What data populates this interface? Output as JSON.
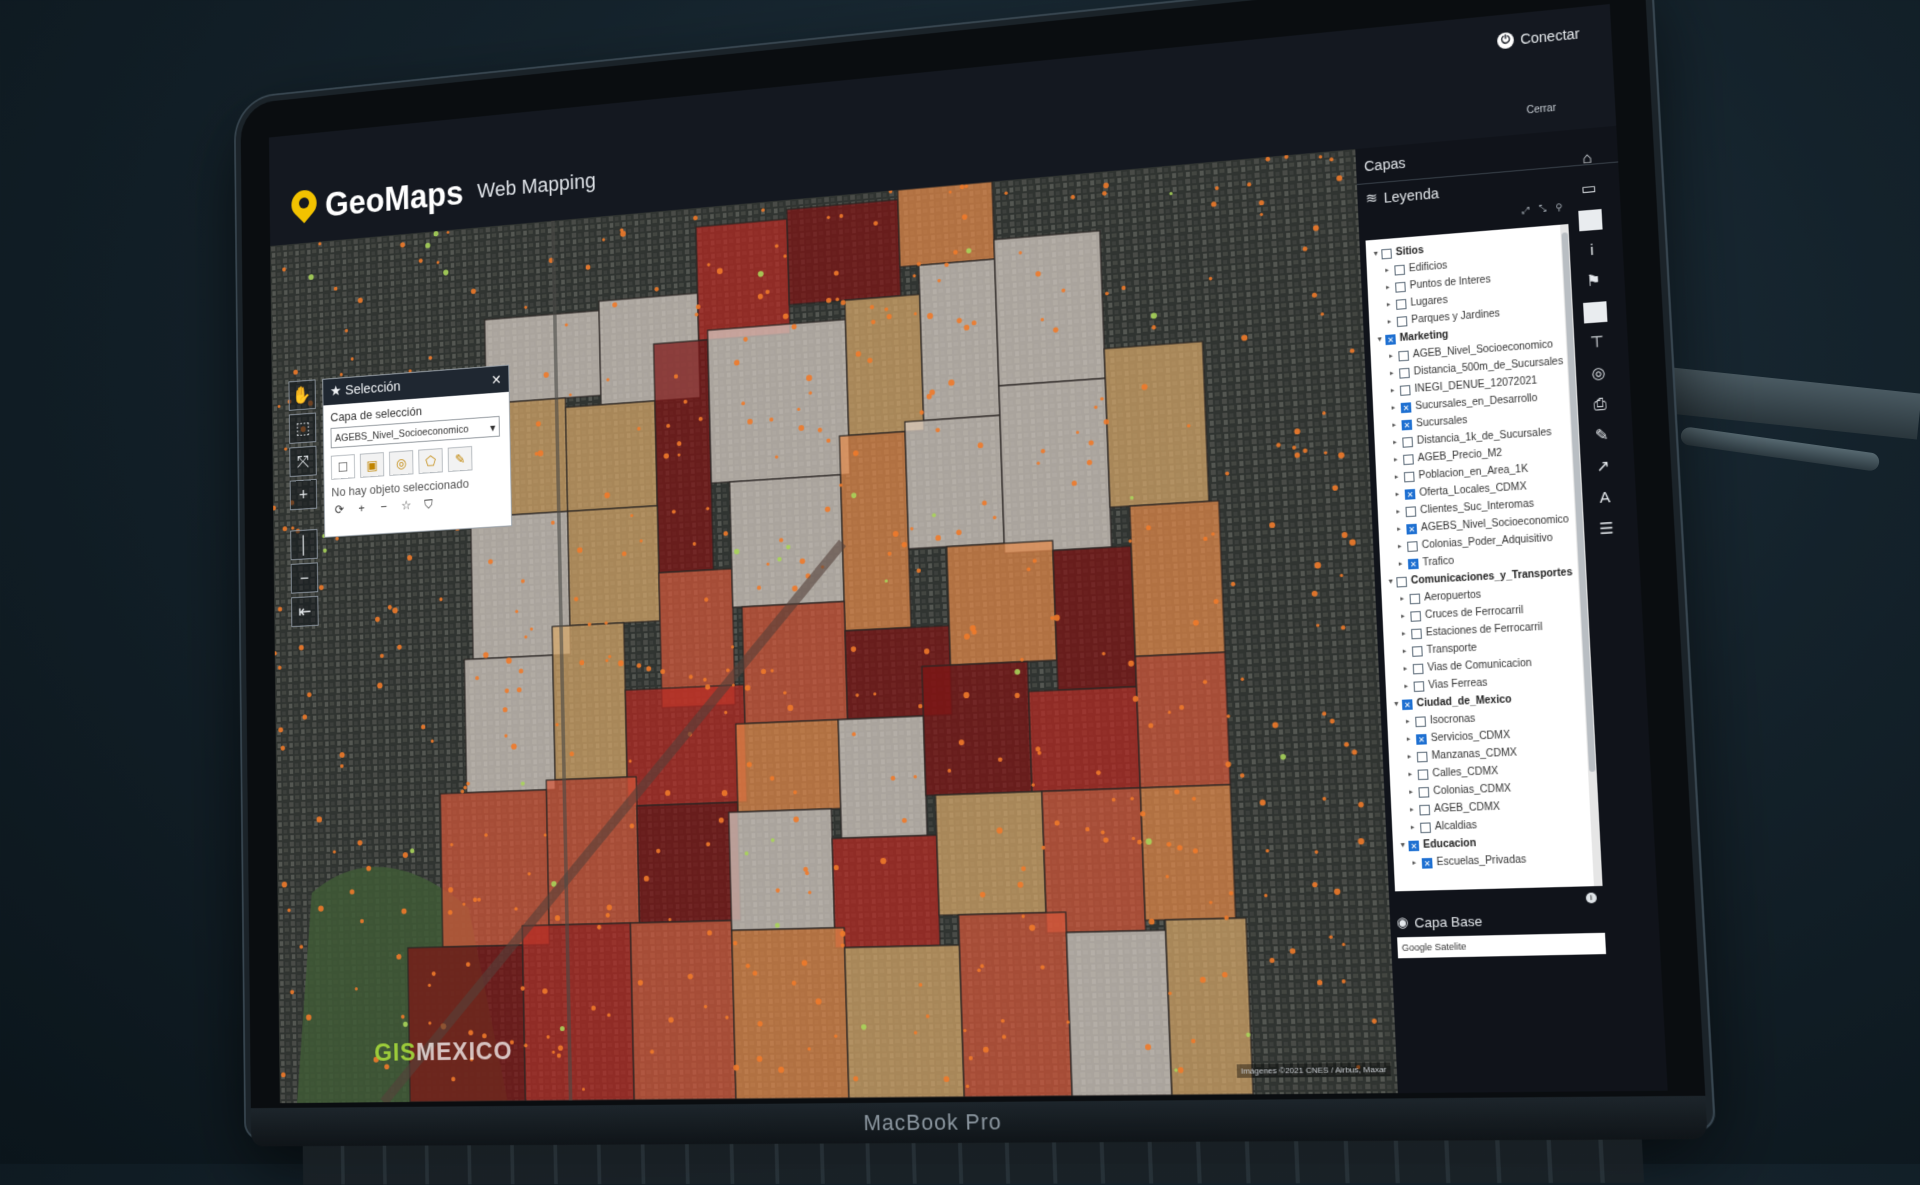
{
  "app": {
    "brand": "GeoMaps",
    "brand_sub": "Web Mapping",
    "connect_label": "Conectar",
    "close_label": "Cerrar"
  },
  "colors": {
    "accent": "#f2c200",
    "dark_bg": "#141820",
    "choropleth": [
      "#d9d0c7",
      "#d7a86a",
      "#e3894a",
      "#d4583a",
      "#b52a22",
      "#7e1515"
    ]
  },
  "selection_panel": {
    "title": "Selección",
    "layer_label": "Capa de selección",
    "layer_value": "AGEBS_Nivel_Socioeconomico",
    "empty_message": "No hay objeto seleccionado"
  },
  "side_panel": {
    "layers_title": "Capas",
    "legend_tab": "Leyenda",
    "base_layer_title": "Capa Base",
    "base_layer_value": "Google Satelite"
  },
  "layer_tree": [
    {
      "label": "Sitios",
      "group": true,
      "checked": false,
      "indent": 0
    },
    {
      "label": "Edificios",
      "group": false,
      "checked": false,
      "indent": 1
    },
    {
      "label": "Puntos de Interes",
      "group": false,
      "checked": false,
      "indent": 1
    },
    {
      "label": "Lugares",
      "group": false,
      "checked": false,
      "indent": 1
    },
    {
      "label": "Parques y Jardines",
      "group": false,
      "checked": false,
      "indent": 1
    },
    {
      "label": "Marketing",
      "group": true,
      "checked": true,
      "indent": 0
    },
    {
      "label": "AGEB_Nivel_Socioeconomico",
      "group": false,
      "checked": false,
      "indent": 1
    },
    {
      "label": "Distancia_500m_de_Sucursales",
      "group": false,
      "checked": false,
      "indent": 1
    },
    {
      "label": "INEGI_DENUE_12072021",
      "group": false,
      "checked": false,
      "indent": 1
    },
    {
      "label": "Sucursales_en_Desarrollo",
      "group": false,
      "checked": true,
      "indent": 1
    },
    {
      "label": "Sucursales",
      "group": false,
      "checked": true,
      "indent": 1
    },
    {
      "label": "Distancia_1k_de_Sucursales",
      "group": false,
      "checked": false,
      "indent": 1
    },
    {
      "label": "AGEB_Precio_M2",
      "group": false,
      "checked": false,
      "indent": 1
    },
    {
      "label": "Poblacion_en_Area_1K",
      "group": false,
      "checked": false,
      "indent": 1
    },
    {
      "label": "Oferta_Locales_CDMX",
      "group": false,
      "checked": true,
      "indent": 1
    },
    {
      "label": "Clientes_Suc_Interomas",
      "group": false,
      "checked": false,
      "indent": 1
    },
    {
      "label": "AGEBS_Nivel_Socioeconomico",
      "group": false,
      "checked": true,
      "indent": 1
    },
    {
      "label": "Colonias_Poder_Adquisitivo",
      "group": false,
      "checked": false,
      "indent": 1
    },
    {
      "label": "Trafico",
      "group": false,
      "checked": true,
      "indent": 1
    },
    {
      "label": "Comunicaciones_y_Transportes",
      "group": true,
      "checked": false,
      "indent": 0
    },
    {
      "label": "Aeropuertos",
      "group": false,
      "checked": false,
      "indent": 1
    },
    {
      "label": "Cruces de Ferrocarril",
      "group": false,
      "checked": false,
      "indent": 1
    },
    {
      "label": "Estaciones de Ferrocarril",
      "group": false,
      "checked": false,
      "indent": 1
    },
    {
      "label": "Transporte",
      "group": false,
      "checked": false,
      "indent": 1
    },
    {
      "label": "Vias de Comunicacion",
      "group": false,
      "checked": false,
      "indent": 1
    },
    {
      "label": "Vias Ferreas",
      "group": false,
      "checked": false,
      "indent": 1
    },
    {
      "label": "Ciudad_de_Mexico",
      "group": true,
      "checked": true,
      "indent": 0
    },
    {
      "label": "Isocronas",
      "group": false,
      "checked": false,
      "indent": 1
    },
    {
      "label": "Servicios_CDMX",
      "group": false,
      "checked": true,
      "indent": 1
    },
    {
      "label": "Manzanas_CDMX",
      "group": false,
      "checked": false,
      "indent": 1
    },
    {
      "label": "Calles_CDMX",
      "group": false,
      "checked": false,
      "indent": 1
    },
    {
      "label": "Colonias_CDMX",
      "group": false,
      "checked": false,
      "indent": 1
    },
    {
      "label": "AGEB_CDMX",
      "group": false,
      "checked": false,
      "indent": 1
    },
    {
      "label": "Alcaldias",
      "group": false,
      "checked": false,
      "indent": 1
    },
    {
      "label": "Educacion",
      "group": true,
      "checked": true,
      "indent": 0
    },
    {
      "label": "Escuelas_Privadas",
      "group": false,
      "checked": true,
      "indent": 1
    }
  ],
  "map": {
    "attribution": "Imágenes ©2021 CNES / Airbus, Maxar",
    "watermark_prefix": "GIS",
    "watermark_suffix": "MEXICO"
  },
  "laptop": {
    "model_label": "MacBook Pro"
  }
}
